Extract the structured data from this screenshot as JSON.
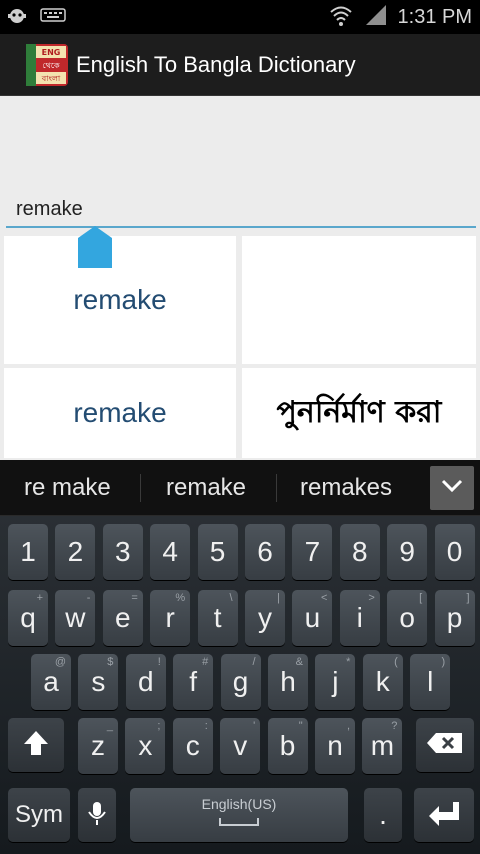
{
  "status_bar": {
    "time": "1:31 PM"
  },
  "app": {
    "title": "English To Bangla Dictionary",
    "icon_text": [
      "ENG",
      "থেকে",
      "বাংলা"
    ]
  },
  "search": {
    "value": "remake"
  },
  "results": {
    "cell_1_word": "remake",
    "cell_2_word": "remake",
    "cell_2_meaning": "পুনর্নির্মাণ করা"
  },
  "suggestions": [
    "re make",
    "remake",
    "remakes"
  ],
  "keyboard": {
    "row_numbers": [
      "1",
      "2",
      "3",
      "4",
      "5",
      "6",
      "7",
      "8",
      "9",
      "0"
    ],
    "row_q": [
      {
        "k": "q",
        "s": "+"
      },
      {
        "k": "w",
        "s": "-"
      },
      {
        "k": "e",
        "s": "="
      },
      {
        "k": "r",
        "s": "%"
      },
      {
        "k": "t",
        "s": "\\"
      },
      {
        "k": "y",
        "s": "|"
      },
      {
        "k": "u",
        "s": "<"
      },
      {
        "k": "i",
        "s": ">"
      },
      {
        "k": "o",
        "s": "["
      },
      {
        "k": "p",
        "s": "]"
      }
    ],
    "row_a": [
      {
        "k": "a",
        "s": "@"
      },
      {
        "k": "s",
        "s": "$"
      },
      {
        "k": "d",
        "s": "!"
      },
      {
        "k": "f",
        "s": "#"
      },
      {
        "k": "g",
        "s": "/"
      },
      {
        "k": "h",
        "s": "&"
      },
      {
        "k": "j",
        "s": "*"
      },
      {
        "k": "k",
        "s": "("
      },
      {
        "k": "l",
        "s": ")"
      }
    ],
    "row_z": [
      {
        "k": "z",
        "s": "_"
      },
      {
        "k": "x",
        "s": ";"
      },
      {
        "k": "c",
        "s": ":"
      },
      {
        "k": "v",
        "s": "'"
      },
      {
        "k": "b",
        "s": "\""
      },
      {
        "k": "n",
        "s": ","
      },
      {
        "k": "m",
        "s": "?"
      }
    ],
    "sym_label": "Sym",
    "space_label": "English(US)",
    "period_label": "."
  }
}
